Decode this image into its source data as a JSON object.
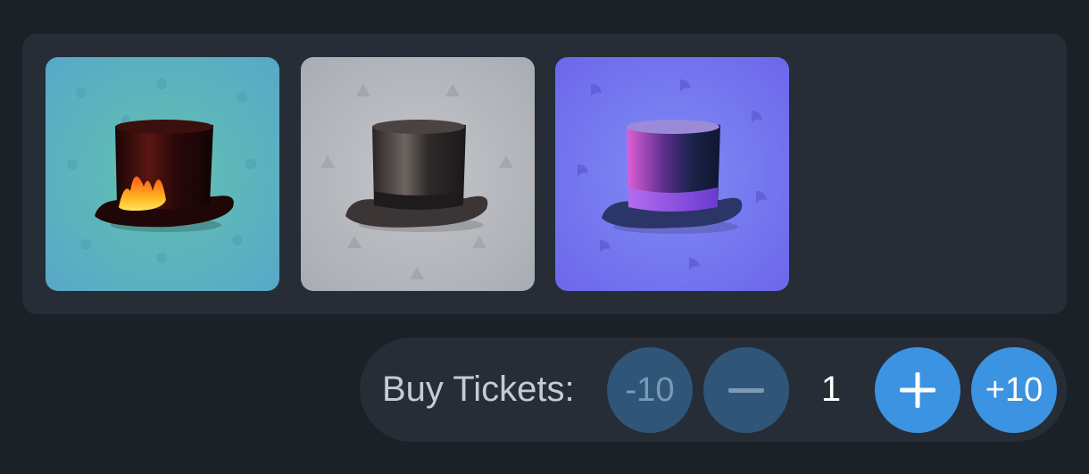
{
  "items": [
    {
      "name": "fire-top-hat-icon",
      "background": "#5fb0c6"
    },
    {
      "name": "classic-top-hat-icon",
      "background": "#b9bcc1"
    },
    {
      "name": "neon-top-hat-icon",
      "background": "#7a6ff0"
    }
  ],
  "tickets": {
    "label": "Buy Tickets:",
    "minus_ten_label": "-10",
    "quantity": "1",
    "plus_ten_label": "+10"
  },
  "colors": {
    "page_background": "#1c2027",
    "panel_background": "#262d37",
    "button_active": "#3c93e2",
    "button_disabled": "#2f5678"
  }
}
